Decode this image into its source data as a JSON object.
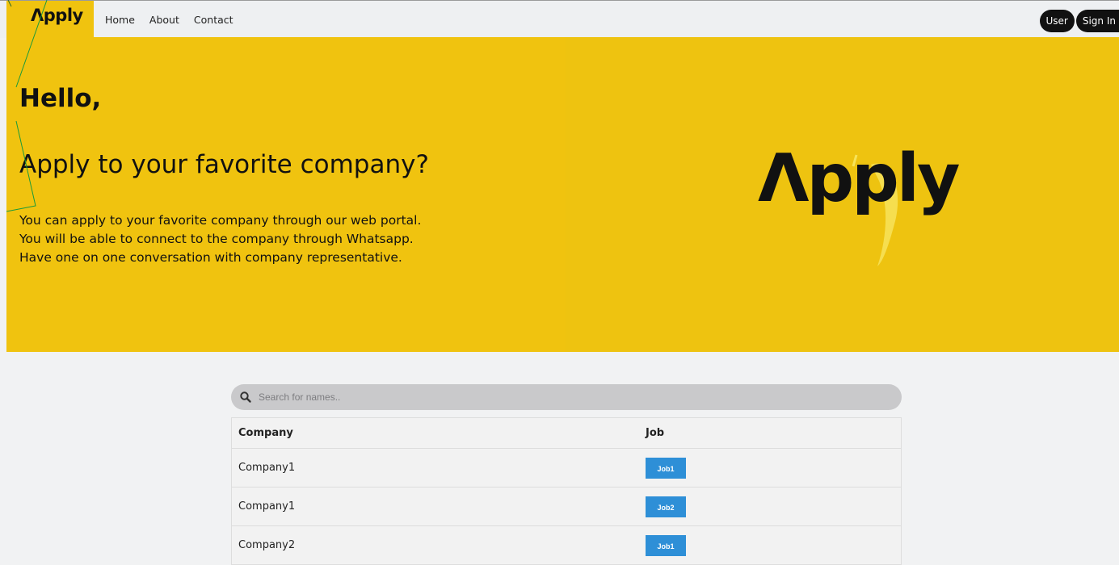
{
  "nav": {
    "brand": "Λpply",
    "links": [
      "Home",
      "About",
      "Contact"
    ],
    "user_label": "User",
    "signin_label": "Sign In"
  },
  "hero": {
    "greeting": "Hello,",
    "subtitle": "Apply to your favorite company?",
    "lines": [
      "You can apply to your favorite company through our web portal.",
      "You will be able to connect to the company through Whatsapp.",
      "Have one on one conversation with company representative."
    ],
    "logo_text": "Λpply"
  },
  "search": {
    "placeholder": "Search for names.."
  },
  "table": {
    "headers": [
      "Company",
      "Job"
    ],
    "rows": [
      {
        "company": "Company1",
        "job": "Job1"
      },
      {
        "company": "Company1",
        "job": "Job2"
      },
      {
        "company": "Company2",
        "job": "Job1"
      }
    ]
  },
  "colors": {
    "brand_yellow": "#f0c30f",
    "button_blue": "#2e8fd7",
    "nav_bg": "#eef0f2"
  }
}
